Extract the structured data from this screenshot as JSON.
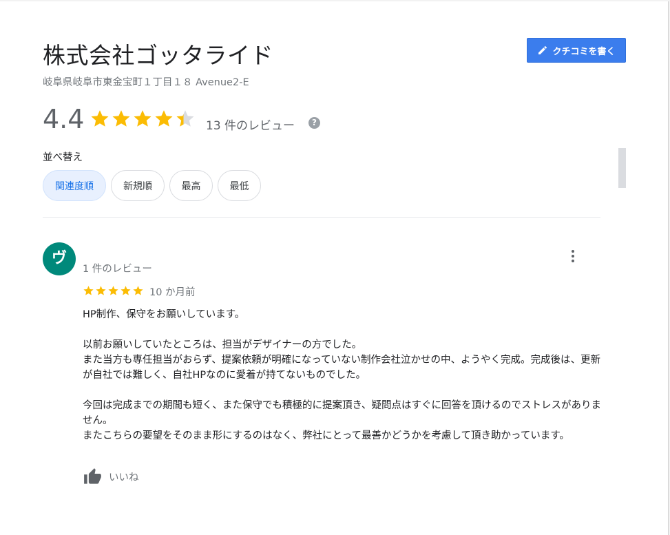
{
  "business": {
    "name": "株式会社ゴッタライド",
    "address": "岐阜県岐阜市東金宝町１丁目１８ Avenue2-E"
  },
  "write_review_button": {
    "label": "クチコミを書く",
    "icon": "pencil-icon"
  },
  "rating": {
    "value": "4.4",
    "stars": 4.4,
    "review_count_text": "13 件のレビュー",
    "help_icon": "?"
  },
  "sort": {
    "label": "並べ替え",
    "options": [
      "関連度順",
      "新規順",
      "最高",
      "最低"
    ],
    "selected": "関連度順"
  },
  "review": {
    "avatar_letter": "ヴ",
    "reviewer_meta": "1 件のレビュー",
    "stars": 5,
    "time": "10 か月前",
    "paragraphs": [
      [
        "HP制作、保守をお願いしています。"
      ],
      [
        "以前お願いしていたところは、担当がデザイナーの方でした。",
        "また当方も専任担当がおらず、提案依頼が明確になっていない制作会社泣かせの中、ようやく完成。完成後は、更新が自社では難しく、自社HPなのに愛着が持てないものでした。"
      ],
      [
        "今回は完成までの期間も短く、また保守でも積極的に提案頂き、疑問点はすぐに回答を頂けるのでストレスがありません。",
        "またこちらの要望をそのまま形にするのはなく、弊社にとって最善かどうかを考慮して頂き助かっています。"
      ]
    ],
    "like_label": "いいね"
  },
  "colors": {
    "star": "#fbbc04",
    "star_empty": "#dadce0",
    "primary_button": "#3b7ded",
    "avatar": "#00897b",
    "selected_chip_bg": "#e8f0fe"
  }
}
